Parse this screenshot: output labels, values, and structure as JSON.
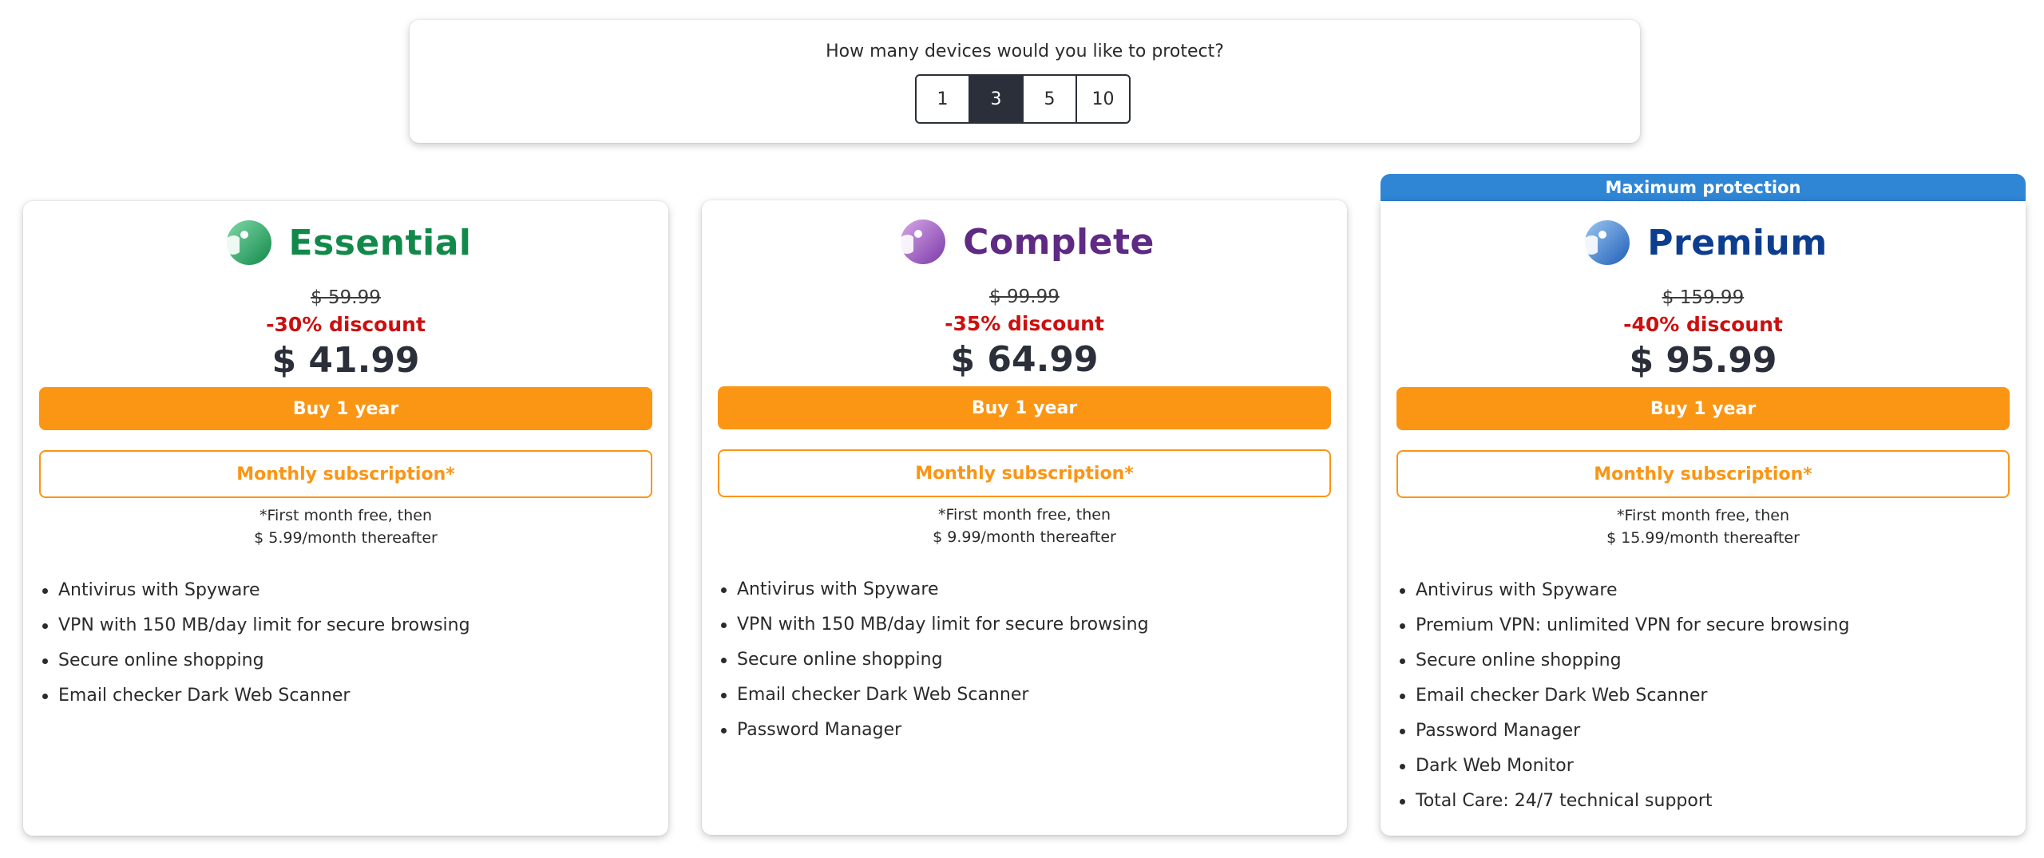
{
  "devices": {
    "question": "How many devices would you like to protect?",
    "options": [
      "1",
      "3",
      "5",
      "10"
    ],
    "selected": "3"
  },
  "plans": [
    {
      "name": "Essential",
      "color": "#12894a",
      "logo_icon": "essential-logo-icon",
      "old_price": "$ 59.99",
      "discount": "-30% discount",
      "price": "$ 41.99",
      "buy_label": "Buy 1 year",
      "monthly_label": "Monthly subscription*",
      "footnote_line1": "*First month free, then",
      "footnote_line2": "$ 5.99/month thereafter",
      "features": [
        "Antivirus with Spyware",
        "VPN with 150 MB/day limit for secure browsing",
        "Secure online shopping",
        "Email checker Dark Web Scanner"
      ]
    },
    {
      "name": "Complete",
      "color": "#5e2a84",
      "logo_icon": "complete-logo-icon",
      "old_price": "$ 99.99",
      "discount": "-35% discount",
      "price": "$ 64.99",
      "buy_label": "Buy 1 year",
      "monthly_label": "Monthly subscription*",
      "footnote_line1": "*First month free, then",
      "footnote_line2": "$ 9.99/month thereafter",
      "features": [
        "Antivirus with Spyware",
        "VPN with 150 MB/day limit for secure browsing",
        "Secure online shopping",
        "Email checker Dark Web Scanner",
        "Password Manager"
      ]
    },
    {
      "name": "Premium",
      "color": "#0d3d8f",
      "logo_icon": "premium-logo-icon",
      "banner": "Maximum protection",
      "old_price": "$ 159.99",
      "discount": "-40% discount",
      "price": "$ 95.99",
      "buy_label": "Buy 1 year",
      "monthly_label": "Monthly subscription*",
      "footnote_line1": "*First month free, then",
      "footnote_line2": "$ 15.99/month thereafter",
      "features": [
        "Antivirus with Spyware",
        "Premium VPN: unlimited VPN for secure browsing",
        "Secure online shopping",
        "Email checker Dark Web Scanner",
        "Password Manager",
        "Dark Web Monitor",
        "Total Care: 24/7 technical support"
      ]
    }
  ],
  "colors": {
    "accent_orange": "#fb9514",
    "discount_red": "#cc0f0f",
    "dark": "#2b2f3a",
    "banner_blue": "#2f86d5"
  }
}
